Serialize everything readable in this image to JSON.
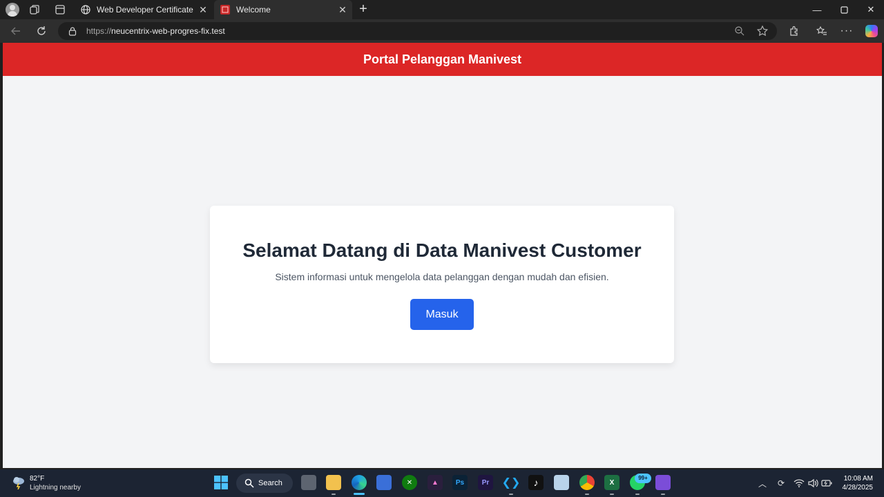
{
  "browser": {
    "tabs": [
      {
        "title": "Web Developer Certificate",
        "icon": "globe-icon",
        "active": false
      },
      {
        "title": "Welcome",
        "icon": "site-favicon",
        "active": true
      }
    ],
    "address": {
      "protocol": "https://",
      "host": "neucentrix-web-progres-fix.test"
    }
  },
  "page": {
    "header_title": "Portal Pelanggan Manivest",
    "welcome_heading": "Selamat Datang di Data Manivest Customer",
    "welcome_subtitle": "Sistem informasi untuk mengelola data pelanggan dengan mudah dan efisien.",
    "login_button": "Masuk",
    "colors": {
      "header": "#dc2626",
      "button": "#2563eb",
      "background": "#f3f4f6"
    }
  },
  "taskbar": {
    "weather_temp": "82°F",
    "weather_desc": "Lightning nearby",
    "search_label": "Search",
    "whatsapp_badge": "99+",
    "time": "10:08 AM",
    "date": "4/28/2025"
  }
}
